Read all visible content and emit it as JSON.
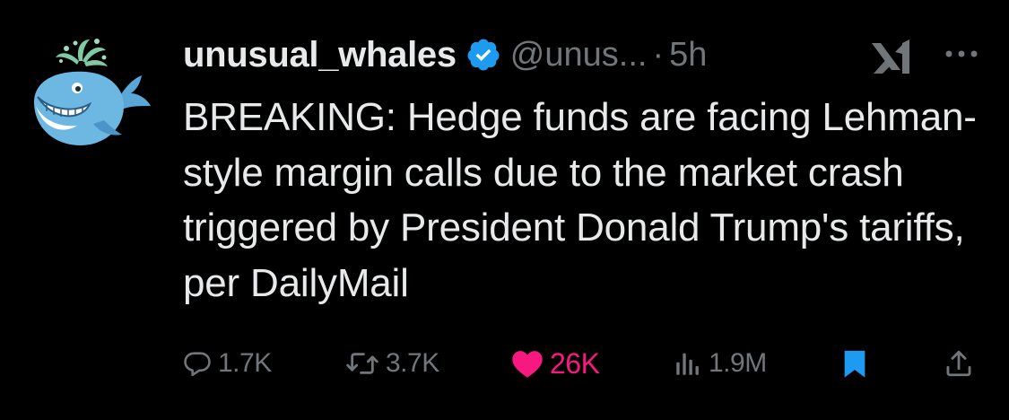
{
  "tweet": {
    "author": {
      "display_name": "unusual_whales",
      "handle": "@unus...",
      "verified": true,
      "avatar_icon": "whale-avatar-icon"
    },
    "separator": "·",
    "time": "5h",
    "text": "BREAKING: Hedge funds are facing Lehman-style margin calls due to the market crash triggered by President Donald Trump's tariffs, per DailyMail"
  },
  "actions": {
    "reply_count": "1.7K",
    "retweet_count": "3.7K",
    "like_count": "26K",
    "views_count": "1.9M"
  },
  "colors": {
    "background": "#000000",
    "text": "#e7e9ea",
    "muted": "#71767b",
    "verified": "#1d9bf0",
    "like": "#f91880",
    "bookmark": "#1d9bf0"
  }
}
